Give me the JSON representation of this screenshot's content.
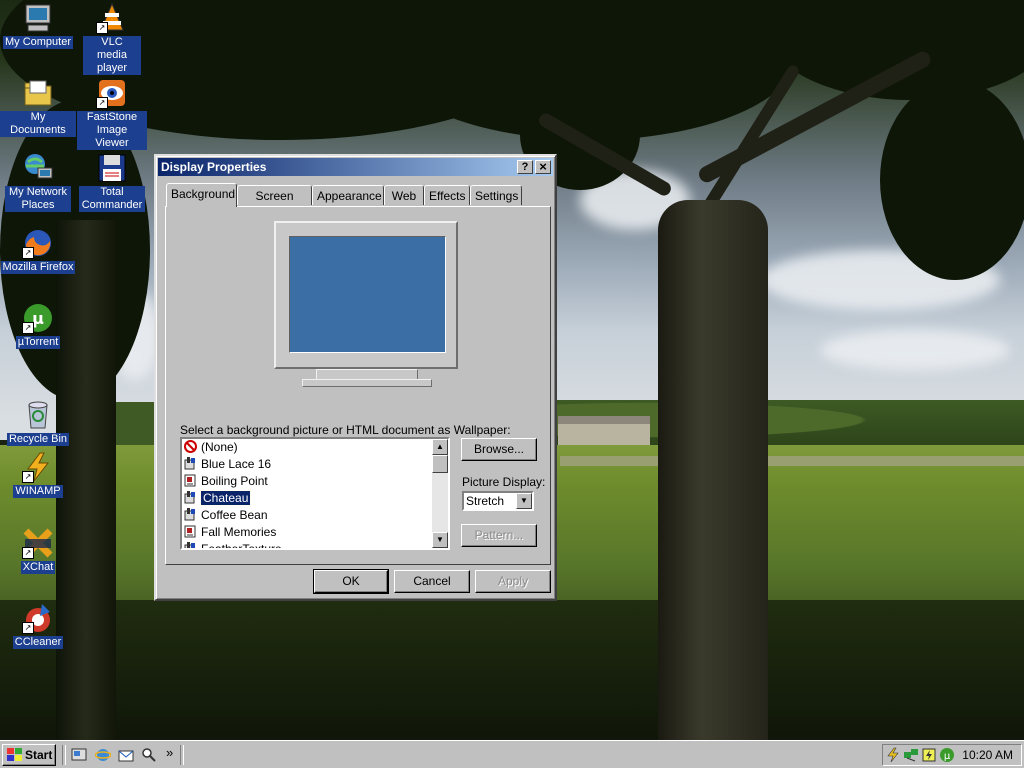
{
  "desktop": {
    "icons": [
      {
        "label": "My Computer",
        "icon": "computer-icon"
      },
      {
        "label": "VLC media player",
        "icon": "vlc-icon"
      },
      {
        "label": "My Documents",
        "icon": "folder-icon"
      },
      {
        "label": "FastStone Image Viewer",
        "icon": "faststone-icon"
      },
      {
        "label": "My Network Places",
        "icon": "network-icon"
      },
      {
        "label": "Total Commander",
        "icon": "floppy-icon"
      },
      {
        "label": "Mozilla Firefox",
        "icon": "firefox-icon"
      },
      {
        "label": "µTorrent",
        "icon": "utorrent-icon"
      },
      {
        "label": "Recycle Bin",
        "icon": "recycle-bin-icon"
      },
      {
        "label": "WINAMP",
        "icon": "winamp-icon"
      },
      {
        "label": "XChat",
        "icon": "xchat-icon"
      },
      {
        "label": "CCleaner",
        "icon": "ccleaner-icon"
      }
    ]
  },
  "dialog": {
    "title": "Display Properties",
    "help_button": "?",
    "close_button": "×",
    "tabs": [
      "Background",
      "Screen Saver",
      "Appearance",
      "Web",
      "Effects",
      "Settings"
    ],
    "active_tab": "Background",
    "preview_color": "#3a6ea5",
    "wallpaper_caption": "Select a background picture or HTML document as Wallpaper:",
    "wallpapers": [
      {
        "name": "(None)",
        "icon": "none-icon"
      },
      {
        "name": "Blue Lace 16",
        "icon": "paint-icon"
      },
      {
        "name": "Boiling Point",
        "icon": "html-icon"
      },
      {
        "name": "Chateau",
        "icon": "paint-icon",
        "selected": true
      },
      {
        "name": "Coffee Bean",
        "icon": "paint-icon"
      },
      {
        "name": "Fall Memories",
        "icon": "html-icon"
      },
      {
        "name": "FeatherTexture",
        "icon": "paint-icon"
      }
    ],
    "browse_button": "Browse...",
    "picture_display_label": "Picture Display:",
    "picture_display_value": "Stretch",
    "pattern_button": "Pattern...",
    "ok_button": "OK",
    "cancel_button": "Cancel",
    "apply_button": "Apply"
  },
  "taskbar": {
    "start_label": "Start",
    "quicklaunch_more": "»",
    "clock": "10:20 AM"
  },
  "colors": {
    "titlebar_start": "#0a246a",
    "titlebar_end": "#a6caf0",
    "selection": "#0a246a",
    "desktop_label_bg": "#1d3f8f"
  }
}
